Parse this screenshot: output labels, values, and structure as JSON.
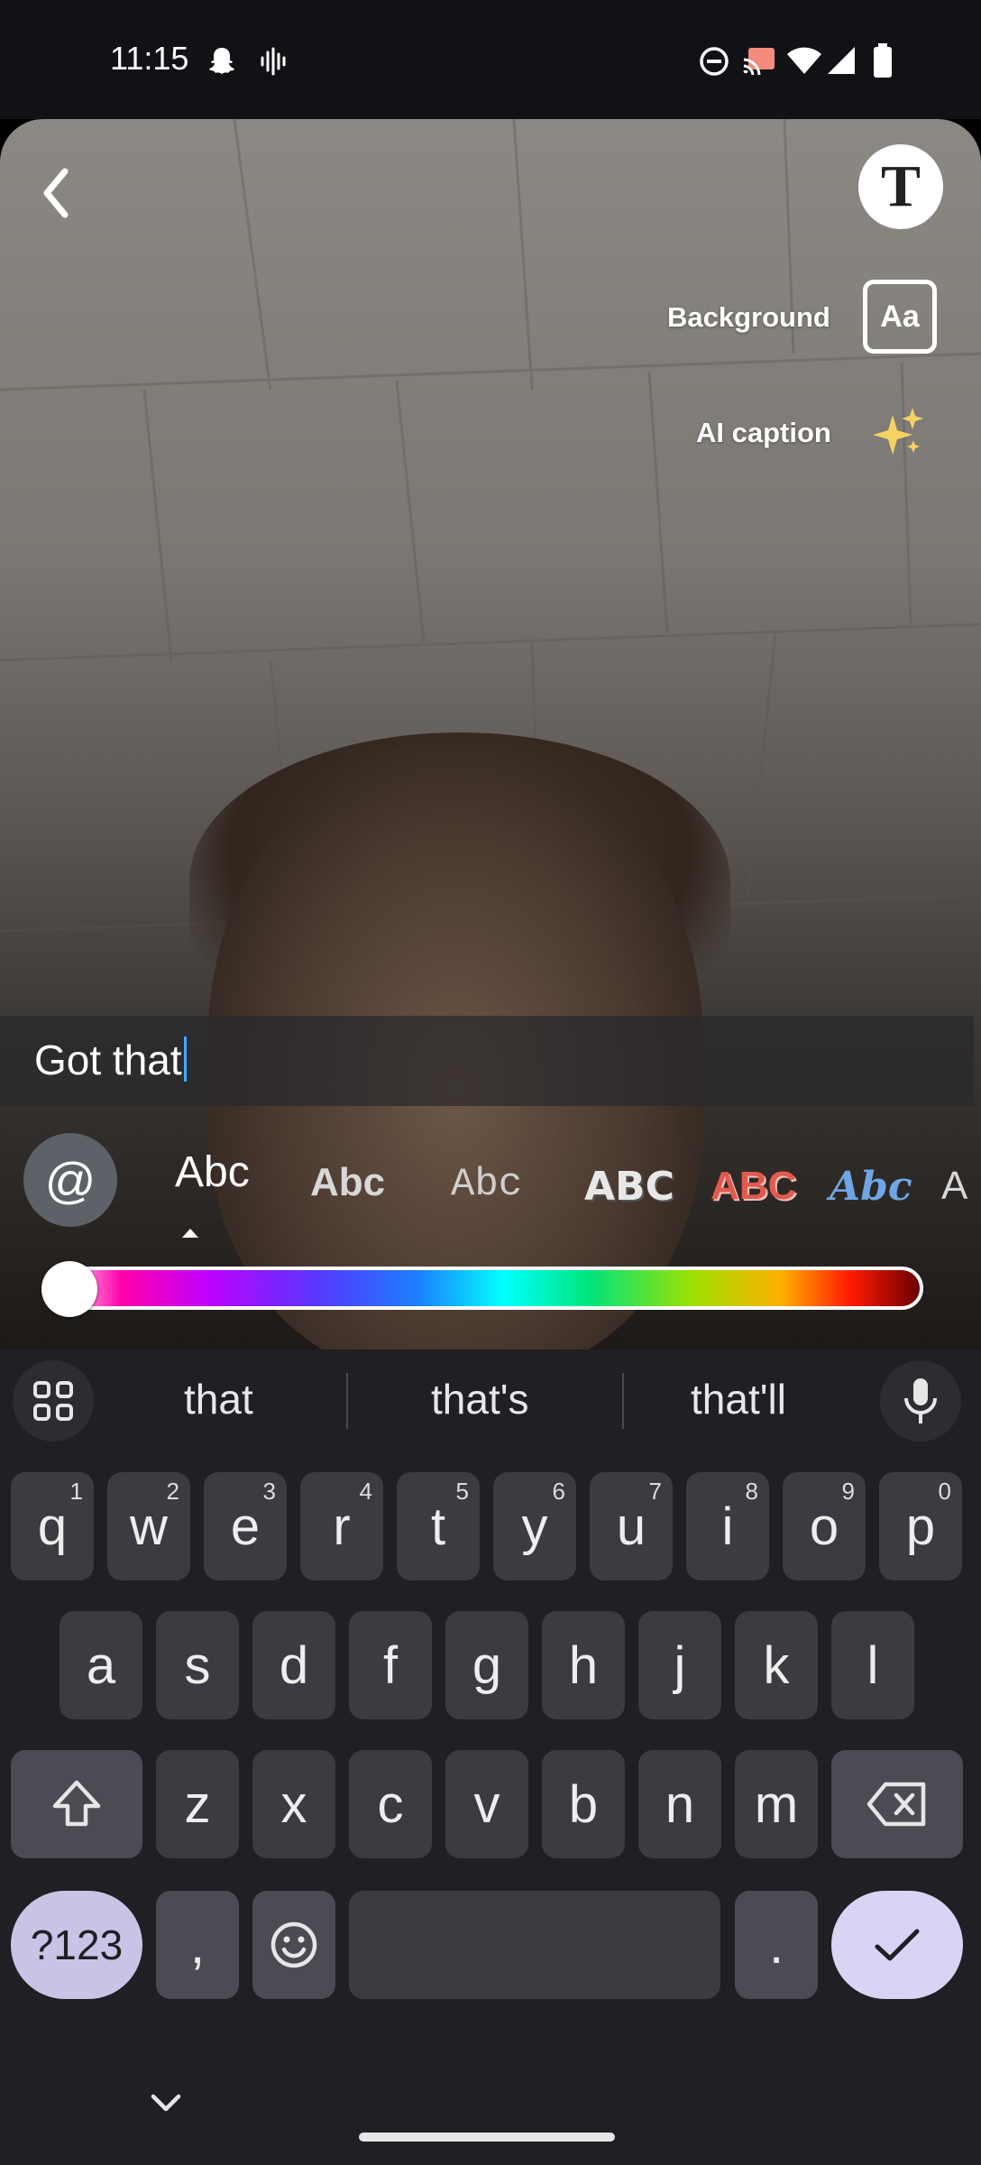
{
  "status_bar": {
    "time": "11:15",
    "icons": [
      "snapchat-ghost-icon",
      "voice-icon",
      "do-not-disturb-icon",
      "cast-icon",
      "wifi-icon",
      "signal-icon",
      "battery-icon"
    ]
  },
  "editor": {
    "back_icon": "chevron-left-icon",
    "text_tool_glyph": "T",
    "background_label": "Background",
    "background_icon_text": "Aa",
    "ai_caption_label": "AI caption",
    "ai_caption_icon": "sparkles-icon"
  },
  "caption": {
    "text": "Got that"
  },
  "font_styles": {
    "mention_symbol": "@",
    "options": [
      "Abc",
      "Abc",
      "Abc",
      "ABC",
      "ABC",
      "Abc",
      "A"
    ],
    "selected_index": 0
  },
  "color_slider": {
    "value": 0
  },
  "keyboard": {
    "suggestions": [
      "that",
      "that's",
      "that'll"
    ],
    "row1": [
      {
        "key": "q",
        "hint": "1"
      },
      {
        "key": "w",
        "hint": "2"
      },
      {
        "key": "e",
        "hint": "3"
      },
      {
        "key": "r",
        "hint": "4"
      },
      {
        "key": "t",
        "hint": "5"
      },
      {
        "key": "y",
        "hint": "6"
      },
      {
        "key": "u",
        "hint": "7"
      },
      {
        "key": "i",
        "hint": "8"
      },
      {
        "key": "o",
        "hint": "9"
      },
      {
        "key": "p",
        "hint": "0"
      }
    ],
    "row2": [
      "a",
      "s",
      "d",
      "f",
      "g",
      "h",
      "j",
      "k",
      "l"
    ],
    "row3": [
      "z",
      "x",
      "c",
      "v",
      "b",
      "n",
      "m"
    ],
    "symbols_label": "?123",
    "comma": ",",
    "period": "."
  },
  "colors": {
    "keyboard_bg": "#1f1f24",
    "key_bg": "#3b3b41",
    "accent_key": "#d9d4f4",
    "caret": "#3fa9ff"
  }
}
